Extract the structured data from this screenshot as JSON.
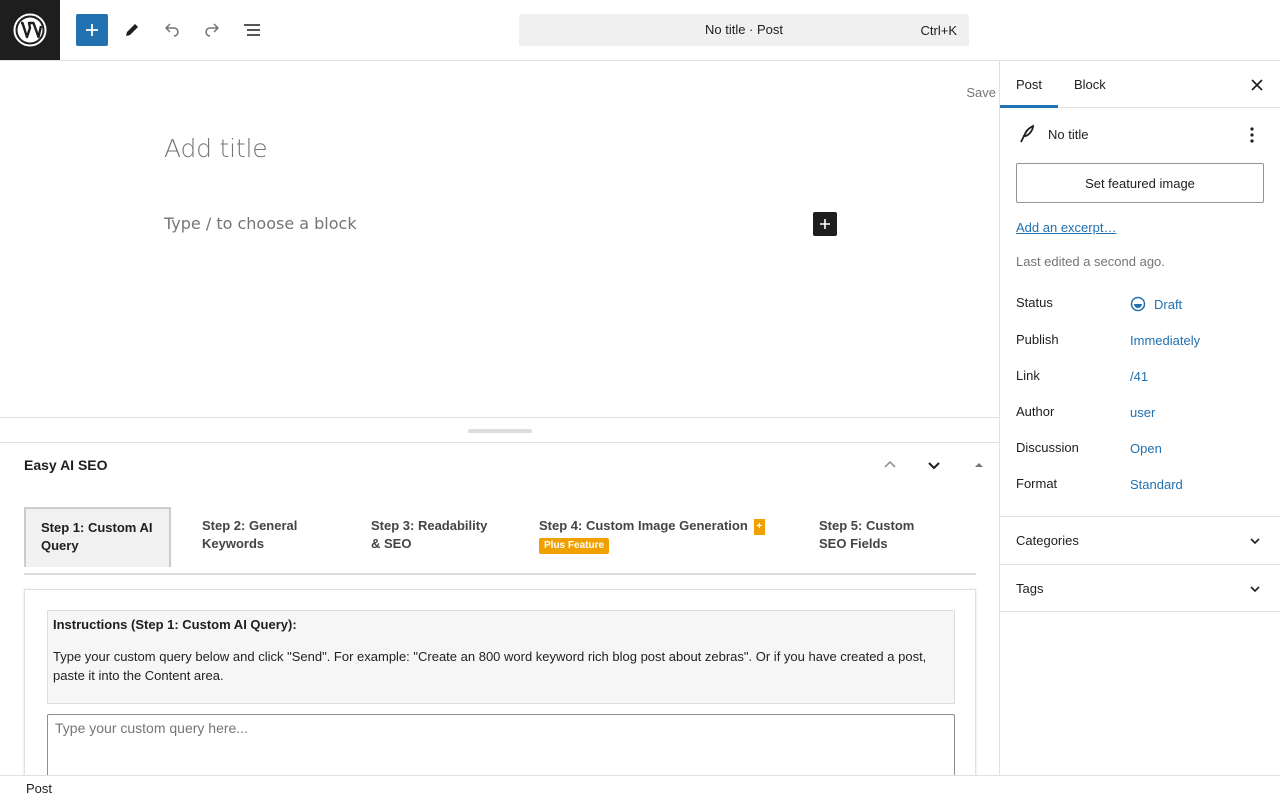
{
  "topbar": {
    "command_title": "No title · Post",
    "command_shortcut": "Ctrl+K"
  },
  "editor": {
    "save_label": "Save",
    "title_placeholder": "Add title",
    "block_placeholder": "Type / to choose a block"
  },
  "metabox": {
    "title": "Easy AI SEO",
    "tabs": [
      {
        "line1": "Step 1: Custom AI",
        "line2": "Query"
      },
      {
        "line1": "Step 2: General",
        "line2": "Keywords"
      },
      {
        "line1": "Step 3: Readability",
        "line2": "& SEO"
      },
      {
        "line1": "Step 4: Custom Image Generation",
        "badge_short": "+",
        "badge": "Plus Feature"
      },
      {
        "line1": "Step 5: Custom",
        "line2": "SEO Fields"
      }
    ],
    "instructions_heading": "Instructions (Step 1: Custom AI Query):",
    "instructions_body": "Type your custom query below and click \"Send\". For example: \"Create an 800 word keyword rich blog post about zebras\". Or if you have created a post, paste it into the Content area.",
    "query_placeholder": "Type your custom query here..."
  },
  "footer": {
    "breadcrumb": "Post"
  },
  "sidebar": {
    "tabs": [
      "Post",
      "Block"
    ],
    "post_title": "No title",
    "featured_image_button": "Set featured image",
    "excerpt_link": "Add an excerpt…",
    "last_edited": "Last edited a second ago.",
    "rows": [
      {
        "label": "Status",
        "value": "Draft"
      },
      {
        "label": "Publish",
        "value": "Immediately"
      },
      {
        "label": "Link",
        "value": "/41"
      },
      {
        "label": "Author",
        "value": "user"
      },
      {
        "label": "Discussion",
        "value": "Open"
      },
      {
        "label": "Format",
        "value": "Standard"
      }
    ],
    "sections": [
      "Categories",
      "Tags"
    ]
  },
  "colors": {
    "accent": "#2271b1",
    "dark": "#1e1e1e",
    "plus_badge": "#f0a000"
  }
}
